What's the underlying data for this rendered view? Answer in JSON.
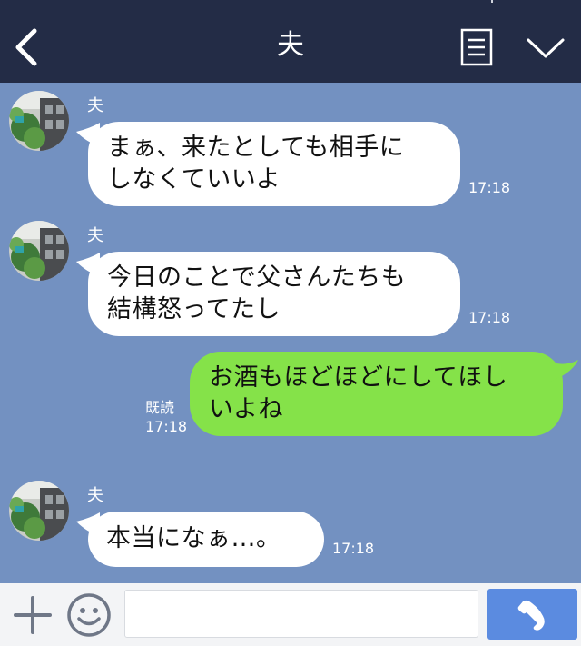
{
  "header": {
    "title": "夫",
    "icons": [
      "back-arrow-icon",
      "menu-icon",
      "chevron-down-icon"
    ]
  },
  "messages": [
    {
      "sender": "夫",
      "direction": "incoming",
      "line1": "まぁ、来たとしても相手に",
      "line2": "しなくていいよ",
      "time": "17:18"
    },
    {
      "sender": "夫",
      "direction": "incoming",
      "line1": "今日のことで父さんたちも",
      "line2": "結構怒ってたし",
      "time": "17:18"
    },
    {
      "direction": "outgoing",
      "line1": "お酒もほどほどにしてほし",
      "line2": "いよね",
      "read_label": "既読",
      "time": "17:18"
    },
    {
      "sender": "夫",
      "direction": "incoming",
      "line1": "本当になぁ…。",
      "time": "17:18"
    }
  ],
  "input_bar": {
    "placeholder": "",
    "icons": [
      "plus-icon",
      "emoji-icon",
      "phone-icon"
    ]
  },
  "colors": {
    "header_bg": "#232c46",
    "chat_bg": "#7391c1",
    "incoming_bubble": "#ffffff",
    "outgoing_bubble": "#85e249",
    "call_button": "#5b8be0"
  }
}
